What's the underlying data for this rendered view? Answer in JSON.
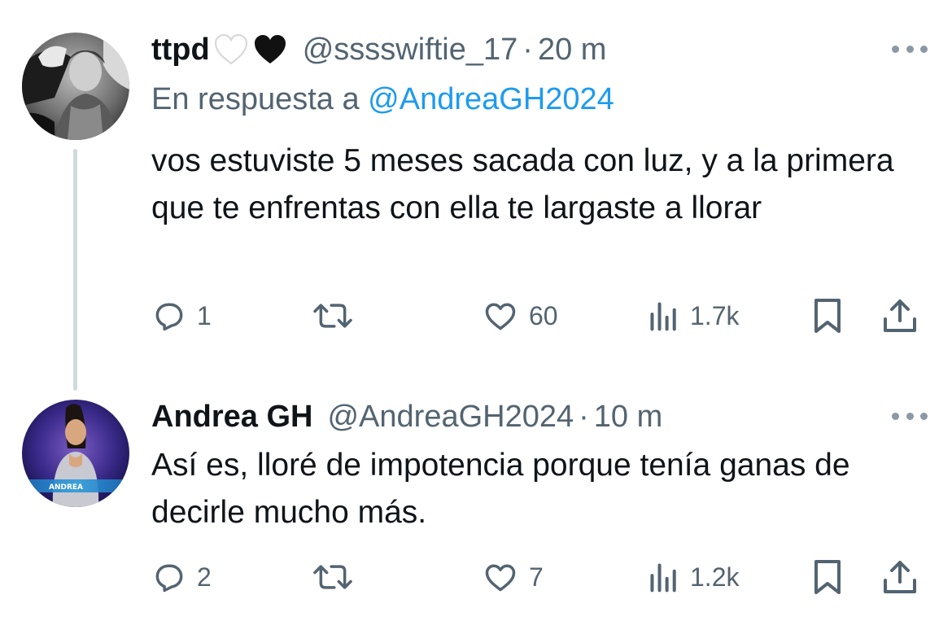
{
  "tweets": [
    {
      "display_name": "ttpd",
      "name_emojis": [
        "white-heart-icon",
        "black-heart-icon"
      ],
      "handle": "@sssswiftie_17",
      "separator": "·",
      "time": "20 m",
      "reply_prefix": "En respuesta a",
      "reply_mention": "@AndreaGH2024",
      "text": "vos estuviste 5 meses sacada con luz, y a la primera que te enfrentas con ella te largaste a llorar",
      "stats": {
        "replies": "1",
        "retweets": "",
        "likes": "60",
        "views": "1.7k"
      }
    },
    {
      "display_name": "Andrea GH",
      "handle": "@AndreaGH2024",
      "separator": "·",
      "time": "10 m",
      "avatar_label": "ANDREA",
      "text": "Así es, lloré de impotencia porque tenía ganas de decirle mucho más.",
      "stats": {
        "replies": "2",
        "retweets": "",
        "likes": "7",
        "views": "1.2k"
      }
    }
  ],
  "colors": {
    "text": "#0f1419",
    "secondary": "#536471",
    "link": "#1d9bf0",
    "thread_line": "#cfd9de"
  }
}
